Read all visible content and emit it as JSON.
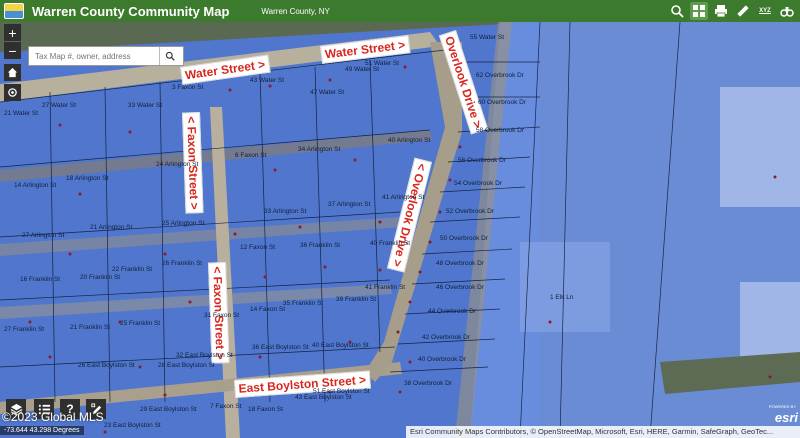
{
  "header": {
    "title": "Warren County Community Map",
    "subtitle": "Warren County, NY",
    "tools": [
      "search-icon",
      "grid-icon",
      "print-icon",
      "measure-icon",
      "xyz-icon",
      "binoculars-icon"
    ],
    "xyz_label": "XYZ"
  },
  "search": {
    "placeholder": "Tax Map #, owner, address"
  },
  "controls": {
    "zoom_in": "+",
    "zoom_out": "−",
    "help": "?"
  },
  "streets": [
    {
      "name": "Water Street >"
    },
    {
      "name": "Water Street >"
    },
    {
      "name": "Overlook Drive >"
    },
    {
      "name": "< Faxon Street >"
    },
    {
      "name": "< Overlook Drive >"
    },
    {
      "name": "< Faxon Street >"
    },
    {
      "name": "East Boylston Street >"
    }
  ],
  "parcels": [
    "55 Water St",
    "51 Water St",
    "49 Water St",
    "43 Water St",
    "47 Water St",
    "27 Water St",
    "33 Water St",
    "21 Water St",
    "3 Faxon St",
    "62 Overbrook Dr",
    "60 Overbrook Dr",
    "58 Overbrook Dr",
    "40 Arlington St",
    "6 Faxon St",
    "34 Arlington St",
    "24 Arlington St",
    "56 Overbrook Dr",
    "54 Overbrook Dr",
    "14 Arlington St",
    "18 Arlington St",
    "41 Arlington St",
    "37 Arlington St",
    "33 Arlington St",
    "52 Overbrook Dr",
    "25 Arlington St",
    "27 Arlington St",
    "21 Arlington St",
    "50 Overbrook Dr",
    "40 Franklin St",
    "12 Faxon St",
    "36 Franklin St",
    "48 Overbrook Dr",
    "16 Franklin St",
    "20 Franklin St",
    "22 Franklin St",
    "26 Franklin St",
    "41 Franklin St",
    "46 Overbrook Dr",
    "35 Franklin St",
    "39 Franklin St",
    "1 Elk Ln",
    "14 Faxon St",
    "44 Overbrook Dr",
    "27 Franklin St",
    "21 Franklin St",
    "25 Franklin St",
    "31 Faxon St",
    "42 Overbrook Dr",
    "36 East Boylston St",
    "40 East Boylston St",
    "32 East Boylston St",
    "40 Overbrook Dr",
    "26 East Boylston St",
    "28 East Boylston St",
    "38 Overbrook Dr",
    "51 East Boylston St",
    "43 East Boylston St",
    "18 Faxon St",
    "7 Faxon St",
    "29 East Boylston St",
    "23 East Boylston St"
  ],
  "footer": {
    "watermark": "©2023 Global MLS",
    "coordinates": "-73.644 43.298 Degrees",
    "attribution": "Esri Community Maps Contributors, © OpenStreetMap, Microsoft, Esri, HERE, Garmin, SafeGraph, GeoTec...",
    "esri": "esri",
    "powered_by": "POWERED BY"
  },
  "colors": {
    "header": "#3c7a2e",
    "parcel_fill": "#4f78d8",
    "street_text": "#d8271e"
  }
}
